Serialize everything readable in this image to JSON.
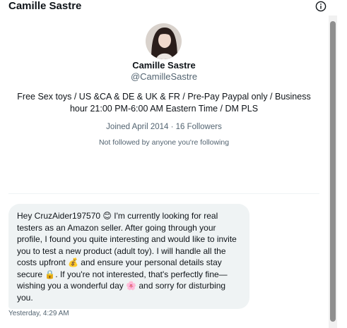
{
  "header": {
    "title": "Camille Sastre",
    "info_icon": "info-icon"
  },
  "profile": {
    "avatar": "profile-photo",
    "name": "Camille Sastre",
    "handle": "@CamilleSastre",
    "bio": "Free Sex toys  / US &CA & DE & UK & FR / Pre-Pay Paypal only / Business hour 21:00 PM-6:00 AM Eastern Time / DM PLS",
    "joined": "Joined April 2014 · 16 Followers",
    "not_followed": "Not followed by anyone you're following"
  },
  "message": {
    "text": "Hey CruzAider197570 😊 I'm currently looking for real testers as an Amazon seller. After going through your profile, I found you quite interesting and would like to invite you to test a new product (adult toy). I will handle all the costs upfront 💰 and ensure your personal details stay secure 🔒. If you're not interested, that's perfectly fine—wishing you a wonderful day 🌸 and sorry for disturbing you.",
    "time": "Yesterday, 4:29 AM"
  },
  "colors": {
    "text_primary": "#0f1419",
    "text_secondary": "#536471",
    "bubble_bg": "#eff3f4",
    "divider": "#eff3f4",
    "scrollbar_thumb": "#8f8f8f"
  }
}
